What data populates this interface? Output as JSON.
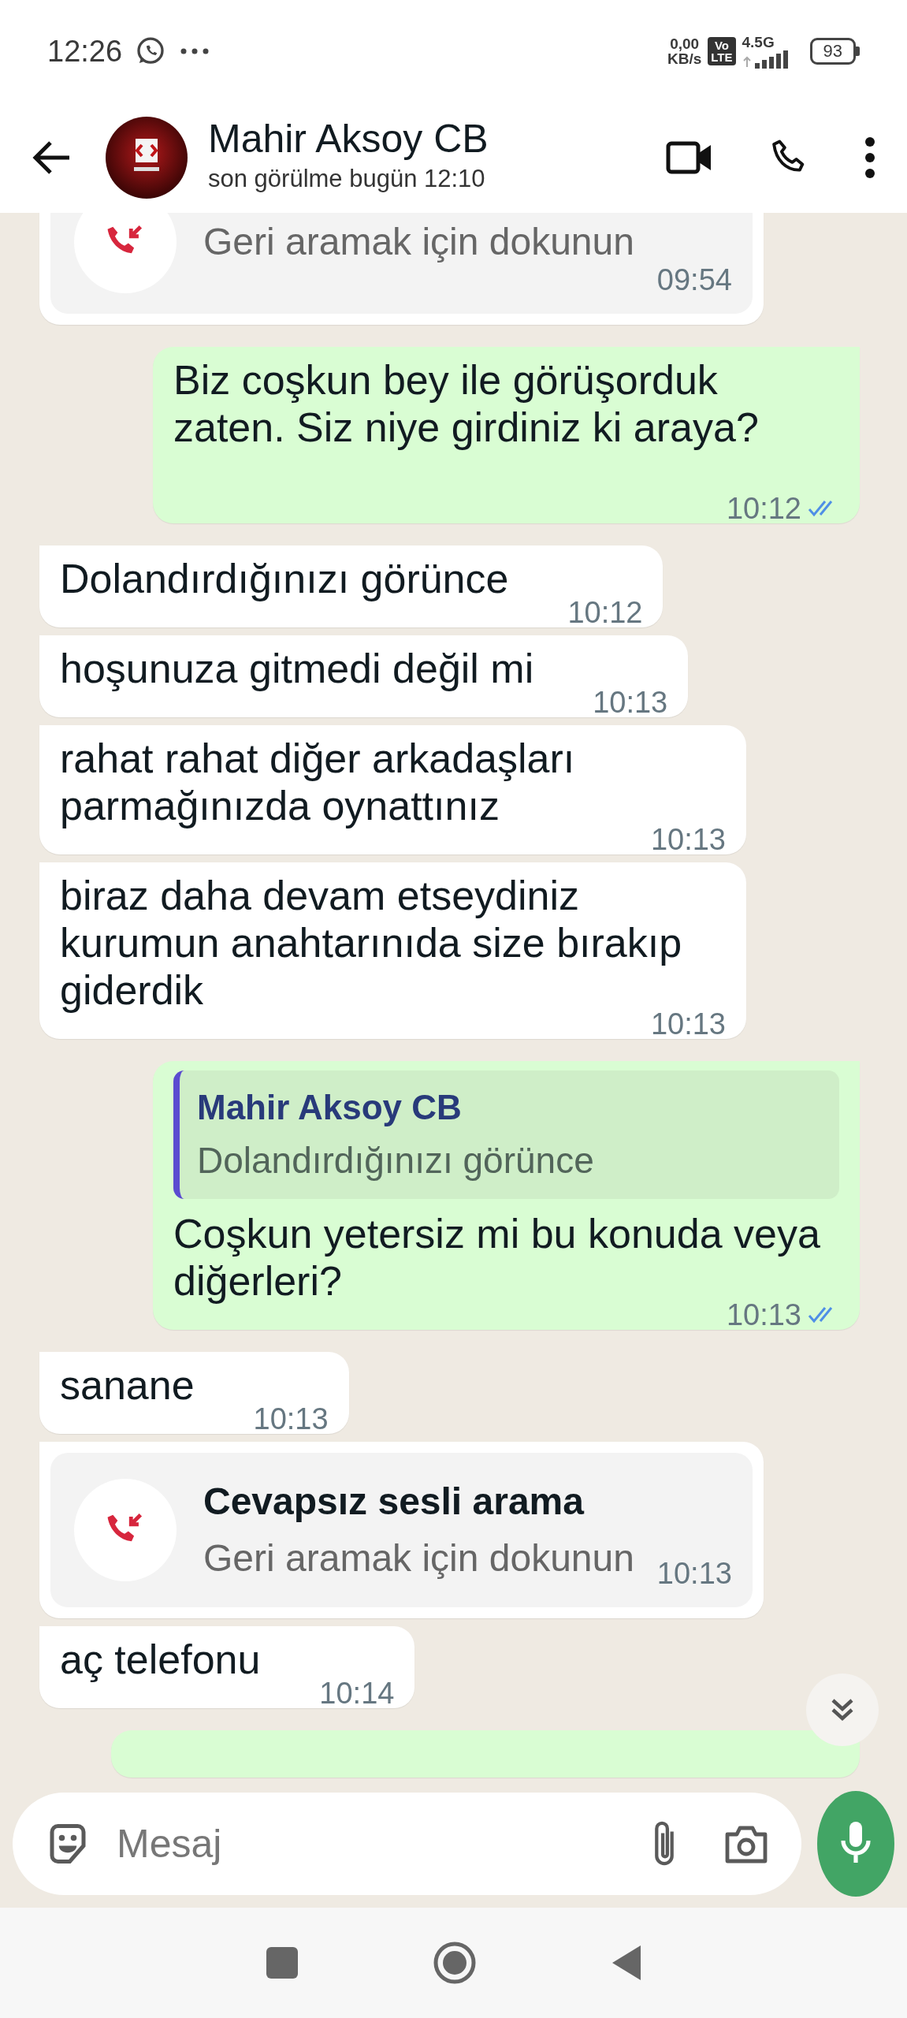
{
  "status_bar": {
    "time": "12:26",
    "data_rate": "0,00",
    "data_unit": "KB/s",
    "volte_top": "Vo",
    "volte_bottom": "LTE",
    "network": "4.5G",
    "battery": "93"
  },
  "header": {
    "name": "Mahir Aksoy CB",
    "status": "son görülme bugün 12:10"
  },
  "messages": [
    {
      "kind": "call",
      "outgoing": false,
      "subtitle": "Geri aramak için dokunun",
      "time": "09:54"
    },
    {
      "kind": "text",
      "outgoing": true,
      "text": "Biz coşkun bey ile görüşorduk zaten. Siz niye girdiniz ki araya?",
      "time": "10:12",
      "read": true
    },
    {
      "kind": "text",
      "outgoing": false,
      "text": "Dolandırdığınızı görünce",
      "time": "10:12"
    },
    {
      "kind": "text",
      "outgoing": false,
      "text": "hoşunuza gitmedi değil mi",
      "time": "10:13"
    },
    {
      "kind": "text",
      "outgoing": false,
      "text": "rahat rahat diğer arkadaşları parmağınızda oynattınız",
      "time": "10:13"
    },
    {
      "kind": "text",
      "outgoing": false,
      "text": "biraz daha devam etseydiniz kurumun anahtarınıda size bırakıp giderdik",
      "time": "10:13"
    },
    {
      "kind": "text",
      "outgoing": true,
      "quote": {
        "author": "Mahir Aksoy CB",
        "text": "Dolandırdığınızı görünce"
      },
      "text": "Coşkun yetersiz mi bu konuda veya diğerleri?",
      "time": "10:13",
      "read": true
    },
    {
      "kind": "text",
      "outgoing": false,
      "text": "sanane",
      "time": "10:13"
    },
    {
      "kind": "call",
      "outgoing": false,
      "title": "Cevapsız sesli arama",
      "subtitle": "Geri aramak için dokunun",
      "time": "10:13"
    },
    {
      "kind": "text",
      "outgoing": false,
      "text": "aç telefonu",
      "time": "10:14"
    },
    {
      "kind": "partial",
      "outgoing": true
    }
  ],
  "composer": {
    "placeholder": "Mesaj"
  }
}
